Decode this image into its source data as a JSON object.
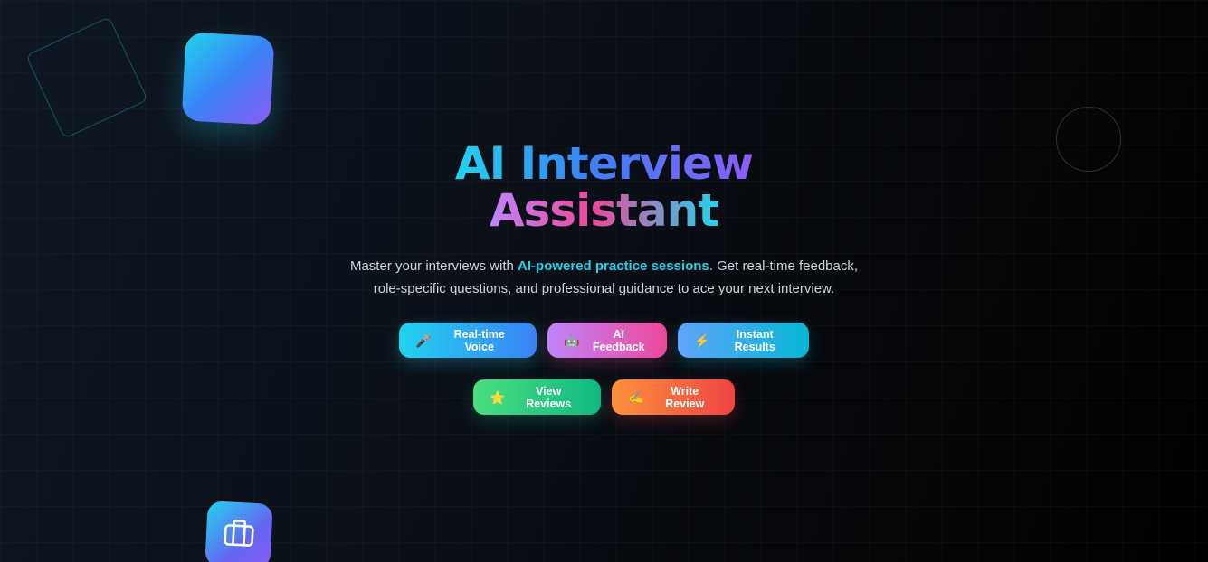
{
  "hero": {
    "title_line1": "AI Interview",
    "title_line2": "Assistant",
    "subtitle_before": "Master your interviews with ",
    "subtitle_highlight": "AI-powered practice sessions",
    "subtitle_after": ". Get real-time feedback, role-specific questions, and professional guidance to ace your next interview."
  },
  "feature_buttons": [
    {
      "label": "Real-time Voice",
      "icon": "microphone-icon",
      "glyph": "🎤"
    },
    {
      "label": "AI Feedback",
      "icon": "robot-icon",
      "glyph": "🤖"
    },
    {
      "label": "Instant Results",
      "icon": "lightning-icon",
      "glyph": "⚡"
    }
  ],
  "review_buttons": [
    {
      "label": "View Reviews",
      "icon": "star-icon",
      "glyph": "⭐"
    },
    {
      "label": "Write Review",
      "icon": "writing-hand-icon",
      "glyph": "✍"
    }
  ],
  "decorations": {
    "briefcase_icon": "briefcase-icon"
  },
  "colors": {
    "accent_cyan": "#22d3ee",
    "accent_blue": "#3b82f6",
    "accent_purple": "#8b5cf6",
    "accent_pink": "#ec4899",
    "accent_green": "#10b981",
    "accent_orange": "#fb923c",
    "background": "#0b1018"
  }
}
